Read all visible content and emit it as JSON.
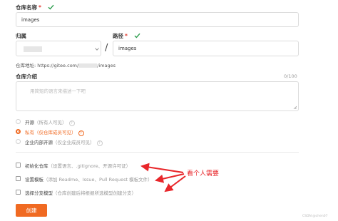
{
  "repo_name": {
    "label": "仓库名称",
    "required_mark": "*",
    "value": "images"
  },
  "owner": {
    "label": "归属",
    "selected_value": ""
  },
  "path": {
    "label": "路径",
    "required_mark": "*",
    "separator": "/",
    "value": "images"
  },
  "repo_url": {
    "label": "仓库地址:",
    "prefix": "https://gitee.com/",
    "suffix": "/images"
  },
  "intro": {
    "label": "仓库介绍",
    "counter": "0/100",
    "placeholder": "用简短的语言来描述一下吧"
  },
  "visibility": {
    "options": [
      {
        "label": "开源",
        "sub": "（所有人可见）",
        "selected": false,
        "disabled": true
      },
      {
        "label": "私有",
        "sub": "（仅仓库成员可见）",
        "selected": true,
        "disabled": false
      },
      {
        "label": "企业内部开源",
        "sub": "（仅企业成员可见）",
        "selected": false,
        "disabled": true
      }
    ]
  },
  "init_options": [
    {
      "label": "初始化仓库",
      "sub": "（设置语言、.gitignore、开源许可证）"
    },
    {
      "label": "设置模板",
      "sub": "（添加 Readme、Issue、Pull Request 模板文件）"
    },
    {
      "label": "选择分支模型",
      "sub": "（仓库创建后将根据所选模型创建分支）"
    }
  ],
  "annotation": {
    "text": "看个人需要",
    "color": "#e8262a"
  },
  "create_button": {
    "label": "创建",
    "color": "#f06a22"
  },
  "watermark": "CSDN @chen07",
  "colors": {
    "accent": "#f06a22",
    "check": "#2e9e4f",
    "required": "#e03c31"
  }
}
